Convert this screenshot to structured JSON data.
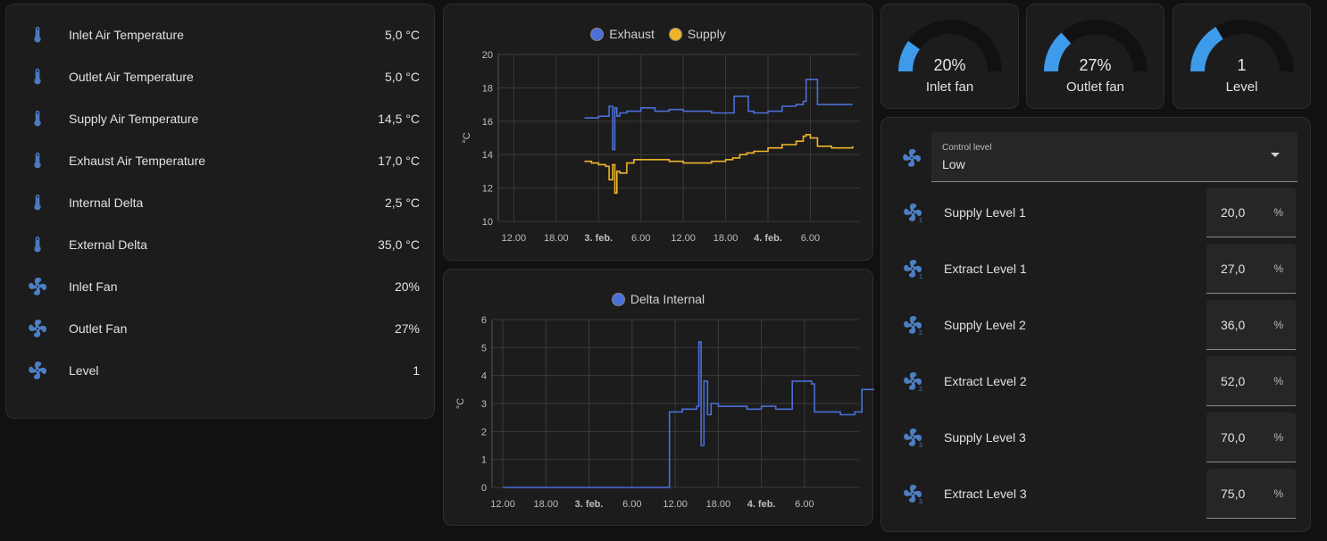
{
  "entities": [
    {
      "label": "Inlet Air Temperature",
      "value": "5,0 °C",
      "icon": "thermometer-icon"
    },
    {
      "label": "Outlet Air Temperature",
      "value": "5,0 °C",
      "icon": "thermometer-icon"
    },
    {
      "label": "Supply Air Temperature",
      "value": "14,5 °C",
      "icon": "thermometer-icon"
    },
    {
      "label": "Exhaust Air Temperature",
      "value": "17,0 °C",
      "icon": "thermometer-icon"
    },
    {
      "label": "Internal Delta",
      "value": "2,5 °C",
      "icon": "thermometer-icon"
    },
    {
      "label": "External Delta",
      "value": "35,0 °C",
      "icon": "thermometer-icon"
    },
    {
      "label": "Inlet Fan",
      "value": "20%",
      "icon": "fan-icon"
    },
    {
      "label": "Outlet Fan",
      "value": "27%",
      "icon": "fan-icon"
    },
    {
      "label": "Level",
      "value": "1",
      "icon": "fan-icon"
    }
  ],
  "gauges": [
    {
      "name": "Inlet fan",
      "value": "20%",
      "fraction": 0.2
    },
    {
      "name": "Outlet fan",
      "value": "27%",
      "fraction": 0.27
    },
    {
      "name": "Level",
      "value": "1",
      "fraction": 0.33
    }
  ],
  "control": {
    "small_label": "Control level",
    "selected": "Low",
    "icon": "fan-icon"
  },
  "levels": [
    {
      "label": "Supply Level 1",
      "value": "20,0",
      "unit": "%",
      "icon": "fan-speed-1-icon"
    },
    {
      "label": "Extract Level 1",
      "value": "27,0",
      "unit": "%",
      "icon": "fan-speed-1-icon"
    },
    {
      "label": "Supply Level 2",
      "value": "36,0",
      "unit": "%",
      "icon": "fan-speed-2-icon"
    },
    {
      "label": "Extract Level 2",
      "value": "52,0",
      "unit": "%",
      "icon": "fan-speed-2-icon"
    },
    {
      "label": "Supply Level 3",
      "value": "70,0",
      "unit": "%",
      "icon": "fan-speed-3-icon"
    },
    {
      "label": "Extract Level 3",
      "value": "75,0",
      "unit": "%",
      "icon": "fan-speed-3-icon"
    }
  ],
  "colors": {
    "blue": "#4a6fd8",
    "amber": "#f0b429",
    "gauge": "#3d9be9",
    "icon": "#4d7ec4"
  },
  "chart_data": [
    {
      "type": "line",
      "title": "",
      "xlabel": "",
      "ylabel": "°C",
      "ylim": [
        10,
        20
      ],
      "yticks": [
        "10",
        "12",
        "14",
        "16",
        "18",
        "20"
      ],
      "xtick_labels": [
        "12.00",
        "18.00",
        "3. feb.",
        "6.00",
        "12.00",
        "18.00",
        "4. feb.",
        "6.00"
      ],
      "xlim_hours": [
        -15,
        66
      ],
      "x_hours_note_free": true,
      "series": [
        {
          "name": "Exhaust",
          "color": "#4a6fd8",
          "x": [
            34,
            35,
            36,
            37,
            37.5,
            38,
            38.3,
            38.6,
            39,
            40,
            41,
            42,
            44,
            46,
            48,
            50,
            52,
            54,
            55,
            55.2,
            57,
            57.2,
            58,
            60,
            62,
            64,
            65,
            65.4,
            66,
            67,
            69,
            71,
            72
          ],
          "y": [
            16.2,
            16.2,
            16.3,
            16.3,
            16.9,
            14.3,
            16.8,
            16.3,
            16.5,
            16.6,
            16.6,
            16.8,
            16.6,
            16.7,
            16.6,
            16.6,
            16.5,
            16.5,
            16.5,
            17.5,
            17.5,
            16.6,
            16.5,
            16.6,
            16.9,
            17.0,
            17.2,
            18.5,
            18.5,
            17.0,
            17.0,
            17.0,
            17.0
          ]
        },
        {
          "name": "Supply",
          "color": "#f0b429",
          "x": [
            34,
            35,
            36,
            37,
            37.5,
            38,
            38.3,
            38.6,
            39,
            40,
            41,
            42,
            44,
            46,
            48,
            50,
            52,
            54,
            55,
            56,
            57,
            58,
            60,
            62,
            64,
            65,
            65.4,
            66,
            67,
            69,
            71,
            72
          ],
          "y": [
            13.6,
            13.5,
            13.4,
            13.3,
            12.5,
            13.4,
            11.7,
            13.0,
            12.9,
            13.5,
            13.7,
            13.7,
            13.7,
            13.6,
            13.5,
            13.5,
            13.6,
            13.7,
            13.8,
            14.0,
            14.1,
            14.2,
            14.4,
            14.6,
            14.8,
            15.1,
            15.2,
            15.0,
            14.5,
            14.4,
            14.4,
            14.5
          ]
        }
      ]
    },
    {
      "type": "line",
      "title": "",
      "xlabel": "",
      "ylabel": "°C",
      "ylim": [
        0,
        6
      ],
      "yticks": [
        "0",
        "1",
        "2",
        "3",
        "4",
        "5",
        "6"
      ],
      "xtick_labels": [
        "12.00",
        "18.00",
        "3. feb.",
        "6.00",
        "12.00",
        "18.00",
        "4. feb.",
        "6.00"
      ],
      "series": [
        {
          "name": "Delta Internal",
          "color": "#4a6fd8",
          "x": [
            -12,
            -6,
            0,
            6,
            10,
            11,
            11.2,
            12,
            13,
            14,
            15,
            15.3,
            15.6,
            16,
            16.5,
            17,
            18,
            20,
            22,
            24,
            26,
            28,
            28.3,
            30,
            31,
            31.4,
            33,
            35,
            37,
            38,
            38.3,
            40,
            42
          ],
          "y": [
            0,
            0,
            0,
            0,
            0,
            0,
            2.7,
            2.7,
            2.8,
            2.8,
            2.9,
            5.2,
            1.5,
            3.8,
            2.6,
            3.0,
            2.9,
            2.9,
            2.8,
            2.9,
            2.8,
            2.8,
            3.8,
            3.8,
            3.7,
            2.7,
            2.7,
            2.6,
            2.7,
            3.5,
            3.5,
            2.6,
            2.5
          ]
        }
      ]
    }
  ]
}
